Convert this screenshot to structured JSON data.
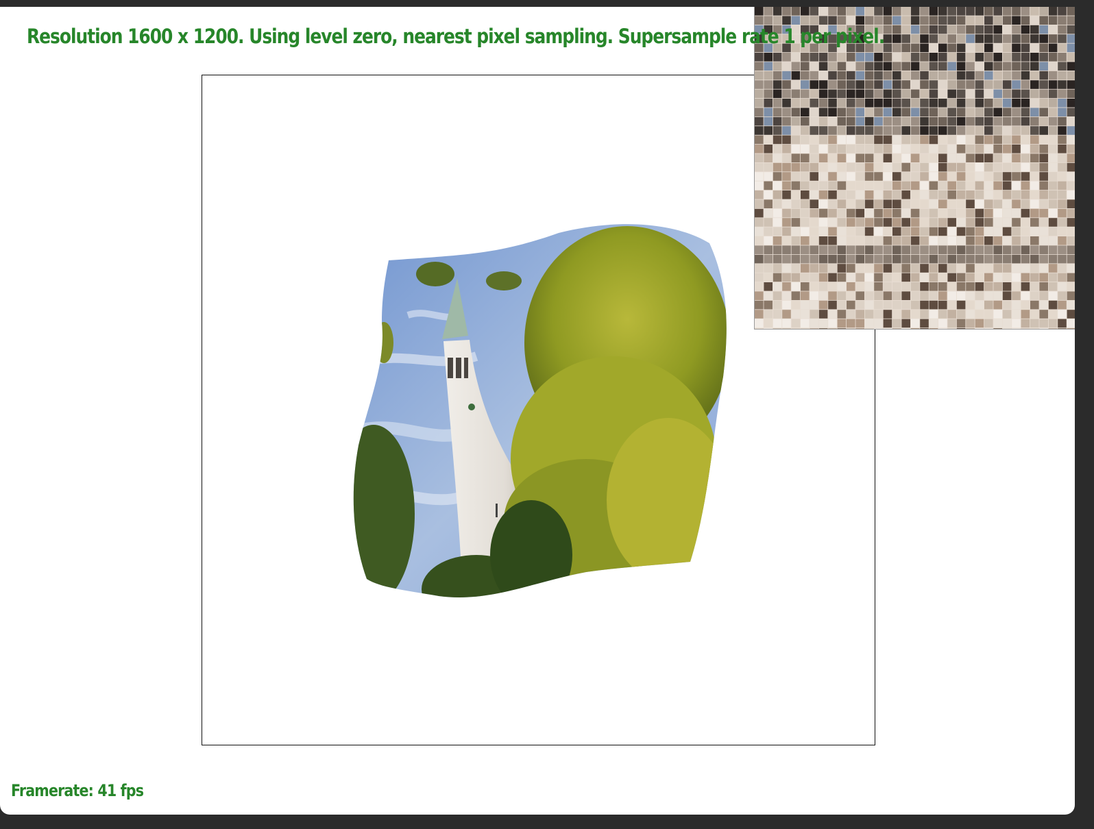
{
  "status": {
    "resolution_text": "Resolution 1600 x 1200. Using level zero, nearest pixel sampling. Supersample rate 1 per pixel."
  },
  "footer": {
    "framerate_text": "Framerate: 41 fps"
  },
  "colors": {
    "text_green": "#27862a",
    "sky": "#7e9fd0",
    "tower": "#e6e2dc",
    "foliage": "#9aa52a",
    "dark_tree": "#3f5a22"
  },
  "zoom": {
    "grid_cells": "pixelated texture magnifier"
  }
}
